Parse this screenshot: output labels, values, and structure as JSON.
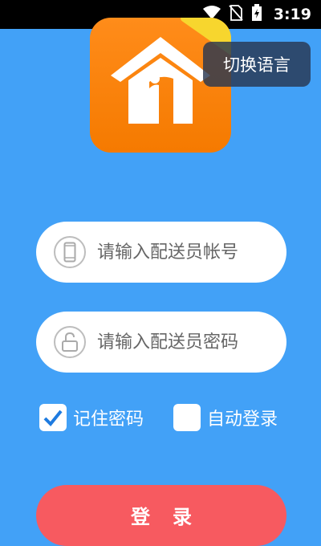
{
  "status_bar": {
    "time": "3:19",
    "icons": [
      "wifi-icon",
      "no-sim-icon",
      "battery-charging-icon"
    ]
  },
  "logo": {
    "icon": "house-logo-icon"
  },
  "language_button": {
    "label": "切换语言"
  },
  "account_field": {
    "icon": "phone-icon",
    "placeholder": "请输入配送员帐号",
    "value": ""
  },
  "password_field": {
    "icon": "unlock-icon",
    "placeholder": "请输入配送员密码",
    "value": ""
  },
  "remember_password": {
    "label": "记住密码",
    "checked": true
  },
  "auto_login": {
    "label": "自动登录",
    "checked": false
  },
  "login_button": {
    "label": "登录"
  },
  "colors": {
    "background": "#42a1f7",
    "logo_orange": "#f57a00",
    "login_button": "#f75a60",
    "check_blue": "#1e7be0"
  }
}
